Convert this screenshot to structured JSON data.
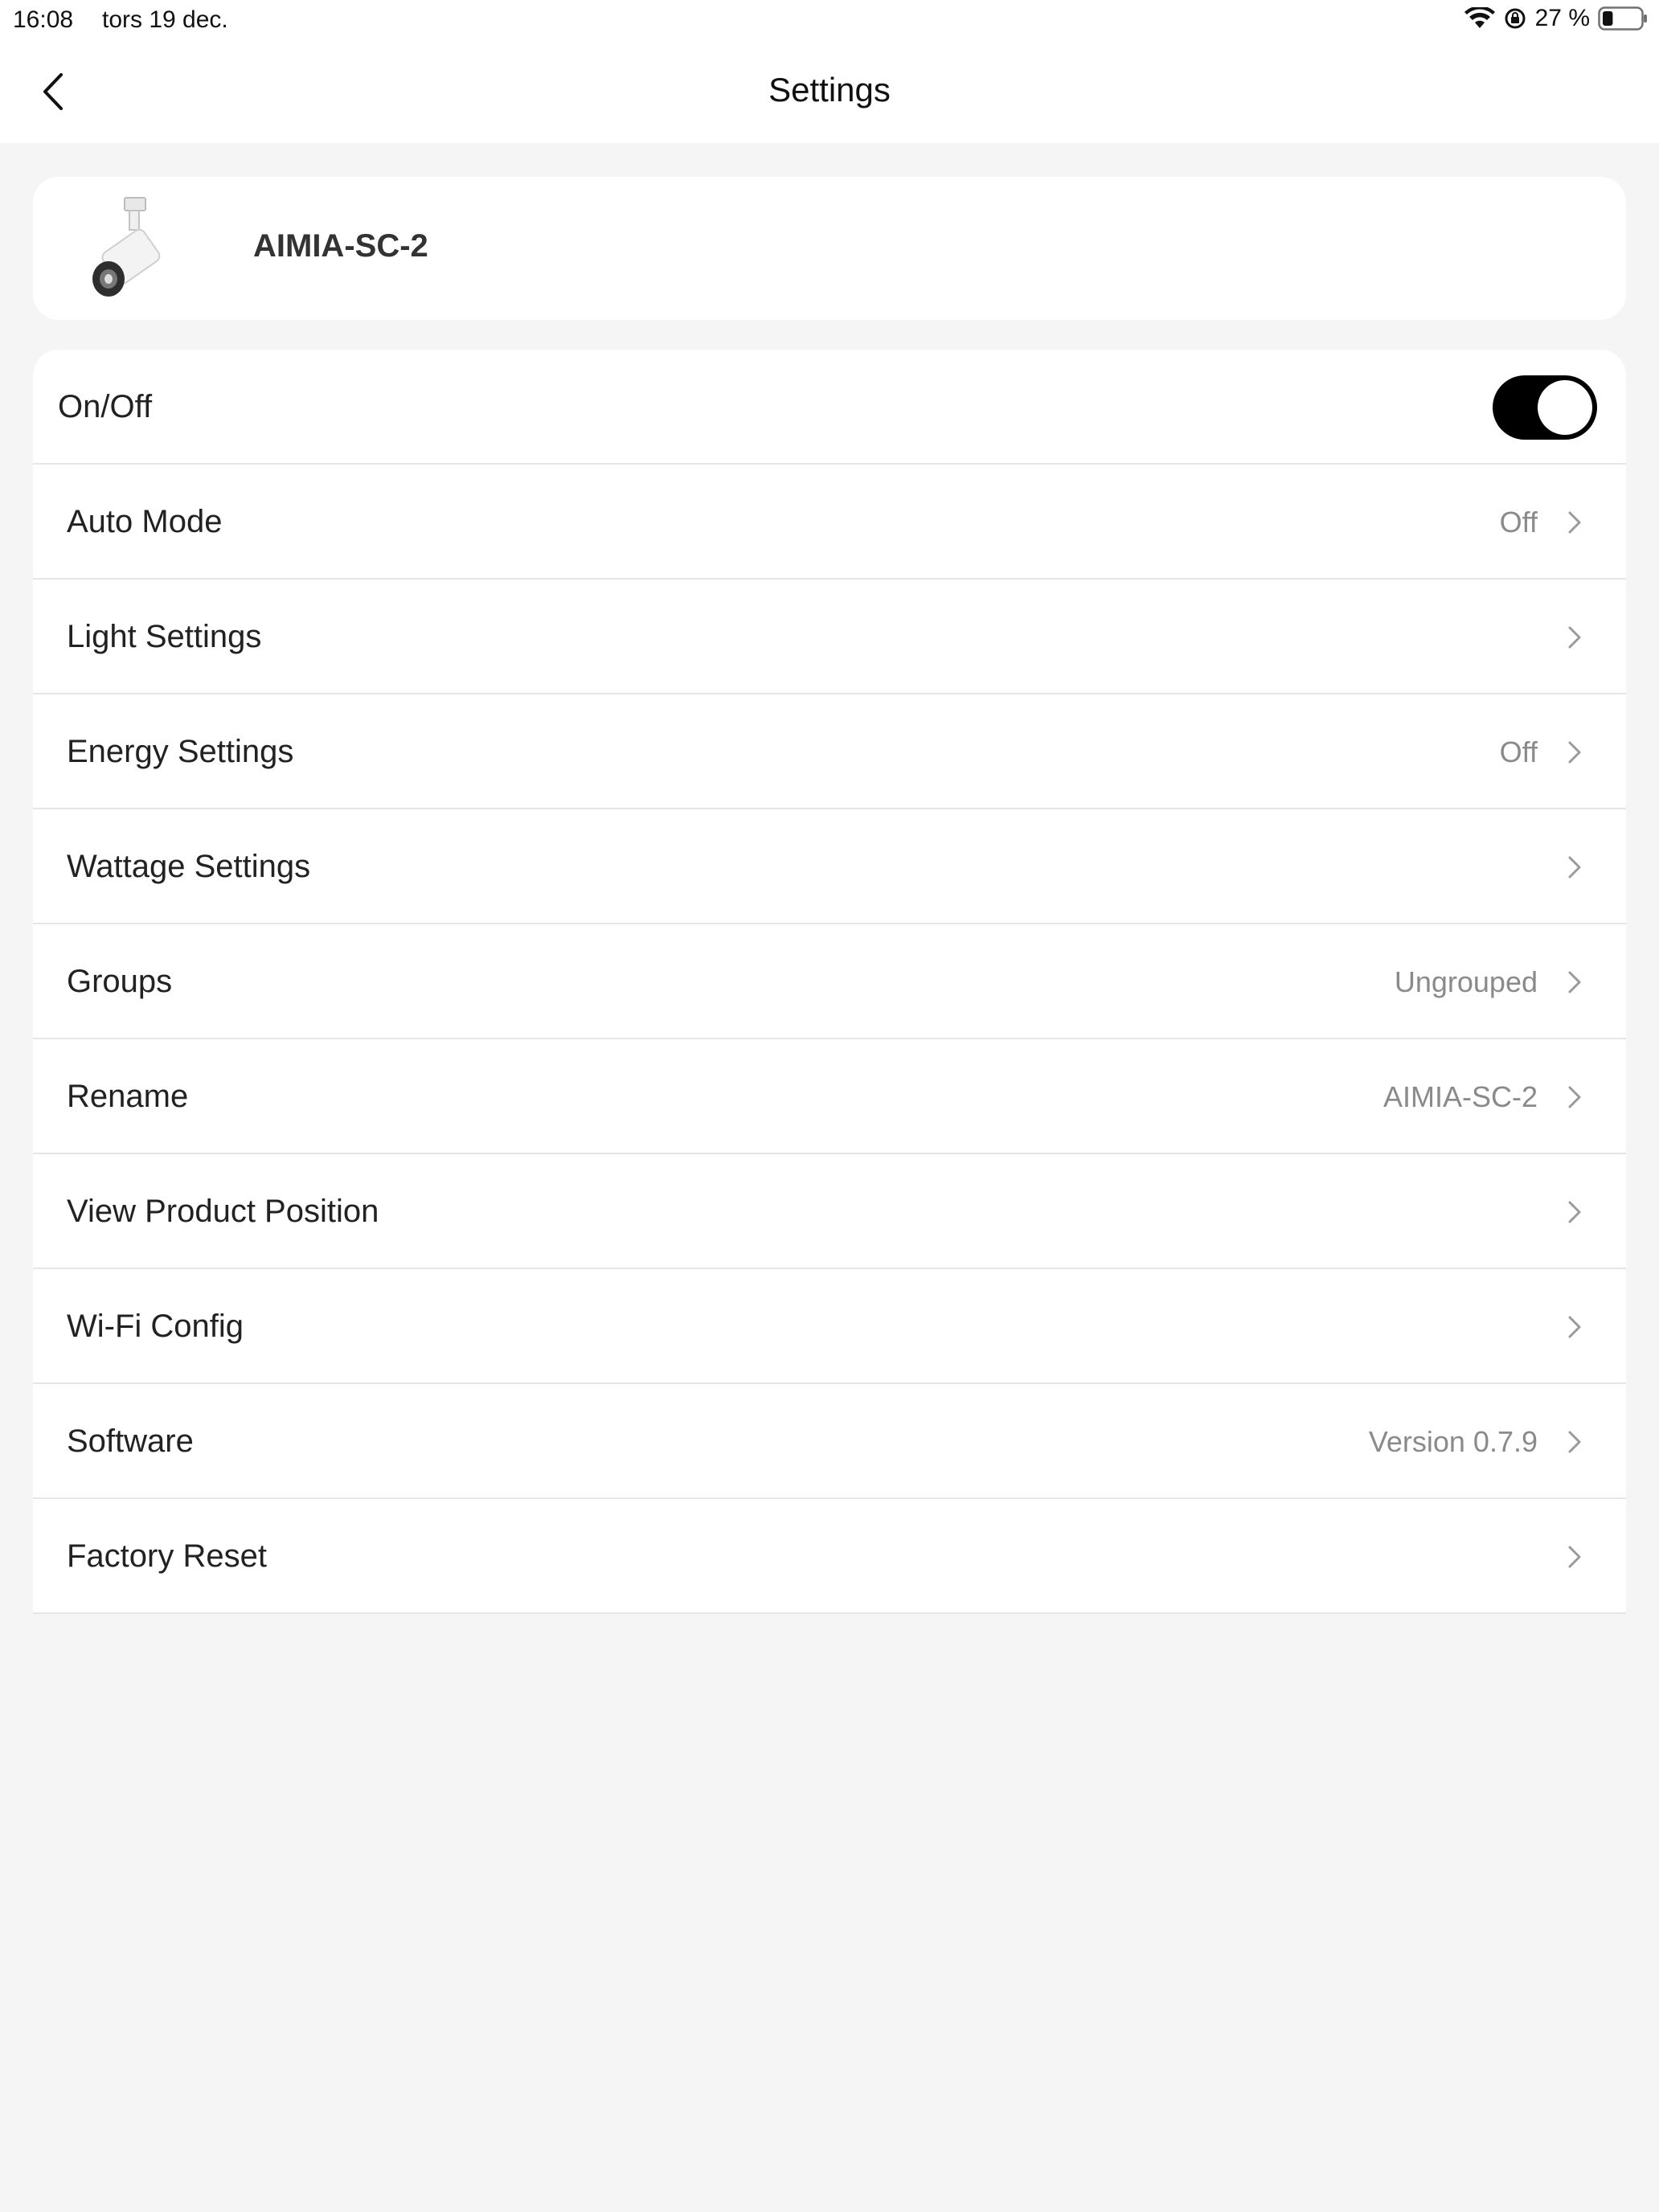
{
  "status_bar": {
    "time": "16:08",
    "date": "tors 19 dec.",
    "battery_percent": "27 %",
    "battery_level": 0.27,
    "icons": [
      "wifi-icon",
      "orientation-lock-icon",
      "battery-icon"
    ]
  },
  "nav": {
    "title": "Settings",
    "back_icon": "chevron-left-icon"
  },
  "device": {
    "name": "AIMIA-SC-2",
    "image": "track-spotlight"
  },
  "settings": {
    "power": {
      "label": "On/Off",
      "on": true
    },
    "rows": [
      {
        "label": "Auto Mode",
        "value": "Off"
      },
      {
        "label": "Light Settings",
        "value": ""
      },
      {
        "label": "Energy Settings",
        "value": "Off"
      },
      {
        "label": "Wattage Settings",
        "value": ""
      },
      {
        "label": "Groups",
        "value": "Ungrouped"
      },
      {
        "label": "Rename",
        "value": "AIMIA-SC-2"
      },
      {
        "label": "View Product Position",
        "value": ""
      },
      {
        "label": "Wi-Fi Config",
        "value": ""
      },
      {
        "label": "Software",
        "value": "Version 0.7.9"
      },
      {
        "label": "Factory Reset",
        "value": ""
      }
    ]
  },
  "colors": {
    "background": "#f5f5f5",
    "card": "#ffffff",
    "toggle_on": "#000000",
    "secondary_text": "#8a8a8a"
  }
}
